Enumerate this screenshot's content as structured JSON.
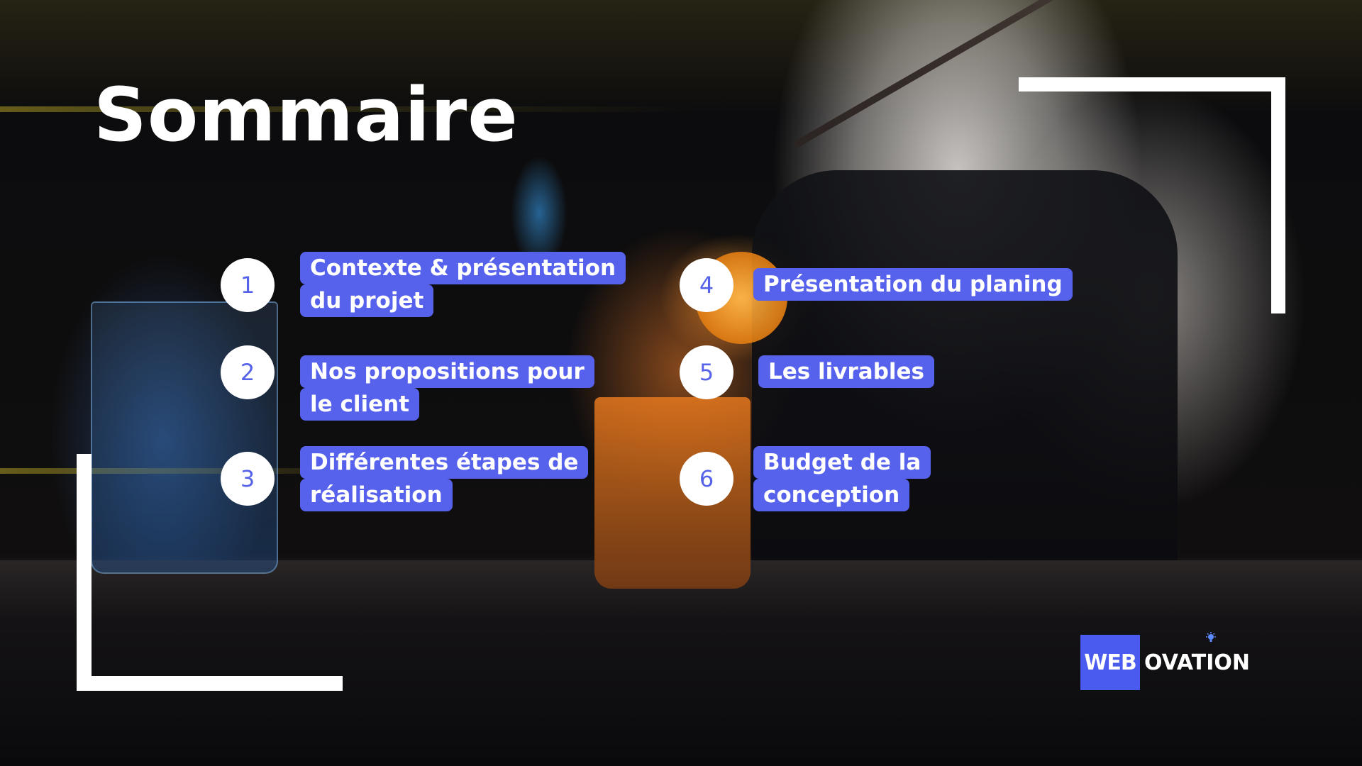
{
  "title": "Sommaire",
  "items": [
    {
      "number": "1",
      "lines": [
        "Contexte & présentation",
        "du projet"
      ]
    },
    {
      "number": "2",
      "lines": [
        "Nos propositions pour",
        "le client"
      ]
    },
    {
      "number": "3",
      "lines": [
        "Différentes étapes de",
        "réalisation"
      ]
    },
    {
      "number": "4",
      "lines": [
        "Présentation du planing"
      ]
    },
    {
      "number": "5",
      "lines": [
        "Les livrables"
      ]
    },
    {
      "number": "6",
      "lines": [
        "Budget de la",
        "conception"
      ]
    }
  ],
  "logo": {
    "part1": "WEB",
    "part2": "OVATION",
    "icon": "lightbulb-icon"
  },
  "colors": {
    "accent": "#5661ec",
    "number_text": "#5662e8",
    "frame": "#ffffff",
    "logo_block": "#4a5bef"
  },
  "background_image": "bartender-cocktail-photo"
}
